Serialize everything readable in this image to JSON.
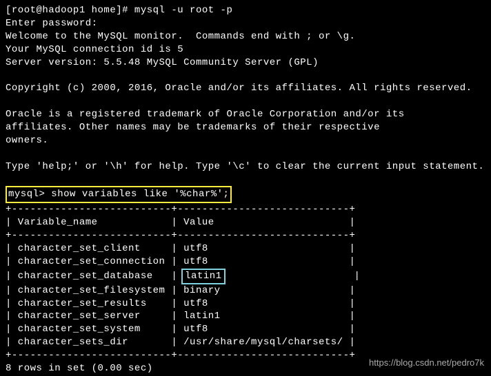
{
  "intro": {
    "prompt": "[root@hadoop1 home]# mysql -u root -p",
    "enter_password": "Enter password:",
    "welcome": "Welcome to the MySQL monitor.  Commands end with ; or \\g.",
    "conn_id": "Your MySQL connection id is 5",
    "server_version": "Server version: 5.5.48 MySQL Community Server (GPL)",
    "copyright": "Copyright (c) 2000, 2016, Oracle and/or its affiliates. All rights reserved.",
    "trademark1": "Oracle is a registered trademark of Oracle Corporation and/or its",
    "trademark2": "affiliates. Other names may be trademarks of their respective",
    "trademark3": "owners.",
    "help": "Type 'help;' or '\\h' for help. Type '\\c' to clear the current input statement."
  },
  "query": {
    "prompt": "mysql> show variables like '%char%';"
  },
  "table": {
    "border_top": "+--------------------------+----------------------------+",
    "border_mid": "+--------------------------+----------------------------+",
    "border_bottom": "+--------------------------+----------------------------+",
    "header": "| Variable_name            | Value                      |",
    "rows": [
      {
        "name": "character_set_client",
        "value": "utf8",
        "highlight": false,
        "line": "| character_set_client     | utf8                       |"
      },
      {
        "name": "character_set_connection",
        "value": "utf8",
        "highlight": false,
        "line": "| character_set_connection | utf8                       |"
      },
      {
        "name": "character_set_database",
        "value": "latin1",
        "highlight": true,
        "prefix": "| character_set_database   | ",
        "highlighted_value": "latin1",
        "suffix": "                     |"
      },
      {
        "name": "character_set_filesystem",
        "value": "binary",
        "highlight": false,
        "line": "| character_set_filesystem | binary                     |"
      },
      {
        "name": "character_set_results",
        "value": "utf8",
        "highlight": false,
        "line": "| character_set_results    | utf8                       |"
      },
      {
        "name": "character_set_server",
        "value": "latin1",
        "highlight": false,
        "line": "| character_set_server     | latin1                     |"
      },
      {
        "name": "character_set_system",
        "value": "utf8",
        "highlight": false,
        "line": "| character_set_system     | utf8                       |"
      },
      {
        "name": "character_sets_dir",
        "value": "/usr/share/mysql/charsets/",
        "highlight": false,
        "line": "| character_sets_dir       | /usr/share/mysql/charsets/ |"
      }
    ]
  },
  "footer": {
    "rows_in_set": "8 rows in set (0.00 sec)"
  },
  "watermark": "https://blog.csdn.net/pedro7k"
}
